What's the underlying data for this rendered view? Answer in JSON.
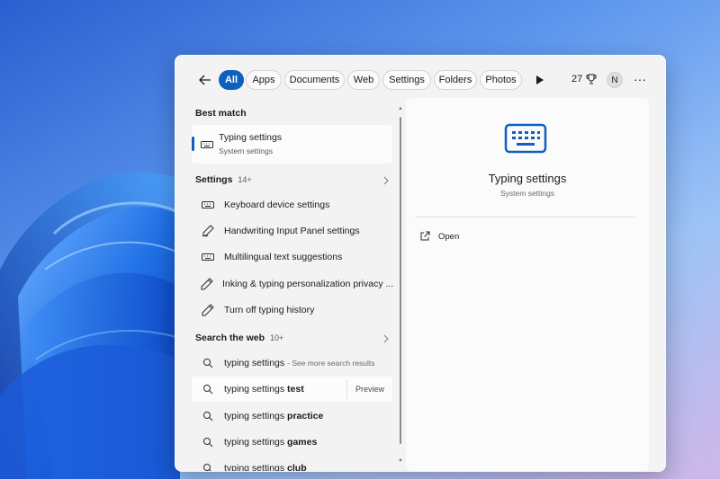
{
  "wallpaper": {
    "name": "Windows 11 bloom"
  },
  "colors": {
    "accent": "#0f5fbe",
    "panel_bg": "#f3f3f3",
    "card_bg": "#fbfbfb",
    "text": "#1b1b1b"
  },
  "topbar": {
    "back_icon": "arrow-left-icon",
    "filters": [
      {
        "label": "All",
        "active": true
      },
      {
        "label": "Apps"
      },
      {
        "label": "Documents"
      },
      {
        "label": "Web"
      },
      {
        "label": "Settings"
      },
      {
        "label": "Folders"
      },
      {
        "label": "Photos"
      }
    ],
    "play_icon": "play-icon",
    "points": "27",
    "points_icon": "trophy-icon",
    "avatar_initial": "N",
    "more_icon": "ellipsis-icon"
  },
  "best_match": {
    "header": "Best match",
    "title": "Typing settings",
    "subtitle": "System settings",
    "icon": "keyboard-icon"
  },
  "settings_section": {
    "header": "Settings",
    "count": "14+",
    "items": [
      {
        "label": "Keyboard device settings",
        "icon": "keyboard-icon"
      },
      {
        "label": "Handwriting Input Panel settings",
        "icon": "handwriting-icon"
      },
      {
        "label": "Multilingual text suggestions",
        "icon": "keyboard-icon"
      },
      {
        "label": "Inking & typing personalization privacy ...",
        "icon": "pen-icon"
      },
      {
        "label": "Turn off typing history",
        "icon": "pen-icon"
      }
    ]
  },
  "web_section": {
    "header": "Search the web",
    "count": "10+",
    "items": [
      {
        "prefix": "typing settings",
        "suffix": "",
        "hint": "- See more search results"
      },
      {
        "prefix": "typing settings ",
        "suffix": "test",
        "hint": "",
        "preview": "Preview"
      },
      {
        "prefix": "typing settings ",
        "suffix": "practice",
        "hint": ""
      },
      {
        "prefix": "typing settings ",
        "suffix": "games",
        "hint": ""
      },
      {
        "prefix": "typing settings ",
        "suffix": "club",
        "hint": ""
      }
    ]
  },
  "detail": {
    "icon": "keyboard-icon",
    "title": "Typing settings",
    "subtitle": "System settings",
    "actions": [
      {
        "label": "Open",
        "icon": "open-external-icon"
      }
    ]
  }
}
